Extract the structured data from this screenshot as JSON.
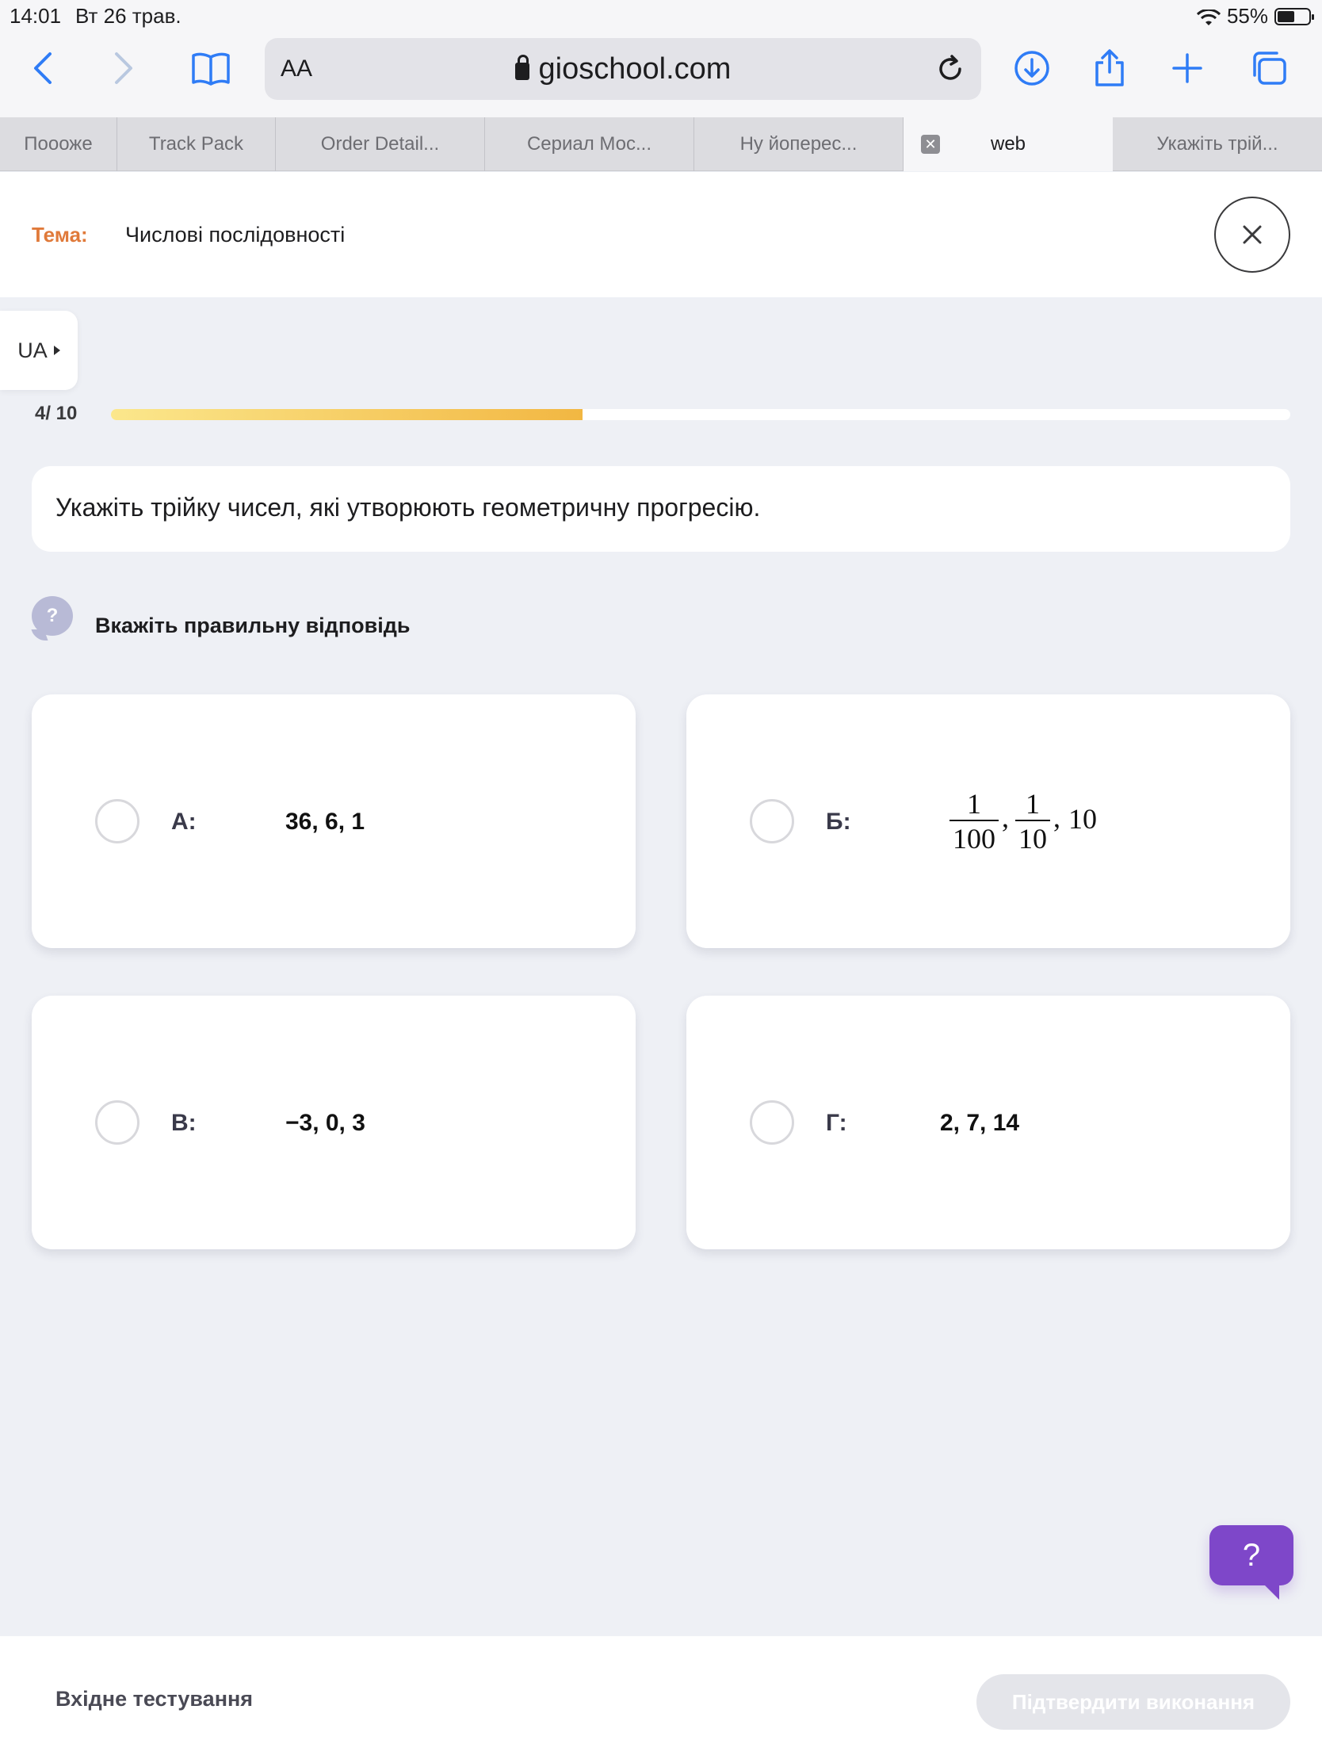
{
  "status_bar": {
    "time": "14:01",
    "date": "Вт 26 трав.",
    "battery": "55%",
    "battery_level": 0.55
  },
  "browser": {
    "reader_label": "AA",
    "url": "gioschool.com",
    "tabs": [
      {
        "label": "Поооже"
      },
      {
        "label": "Track Pack"
      },
      {
        "label": "Order Detail..."
      },
      {
        "label": "Сериал Мос..."
      },
      {
        "label": "Ну йоперес..."
      },
      {
        "label": "web"
      },
      {
        "label": "Укажіть трій..."
      }
    ],
    "active_tab_index": 5
  },
  "header": {
    "topic_label": "Тема:",
    "topic_value": "Числові послідовності"
  },
  "language": {
    "selected": "UA"
  },
  "progress": {
    "text": "4/ 10",
    "current": 4,
    "total": 10,
    "fraction": 0.4
  },
  "question": {
    "text": "Укажіть трійку чисел, які утворюють геометричну прогресію.",
    "hint": "Вкажіть правильну відповідь",
    "hint_icon": "?"
  },
  "options": [
    {
      "letter": "А:",
      "value": "36, 6, 1"
    },
    {
      "letter": "Б:",
      "fraction1": {
        "num": "1",
        "den": "100"
      },
      "fraction2": {
        "num": "1",
        "den": "10"
      },
      "comma": ",",
      "tail": "10"
    },
    {
      "letter": "В:",
      "value": "−3, 0, 3"
    },
    {
      "letter": "Г:",
      "value": "2, 7, 14"
    }
  ],
  "help_button": "?",
  "footer": {
    "left_text": "Вхідне тестування",
    "submit_label": "Підтвердити виконання"
  },
  "colors": {
    "accent_orange": "#e07a3a",
    "progress_start": "#fbe78c",
    "progress_end": "#f2b742",
    "help_purple": "#7e47c9",
    "safari_blue": "#2f7cf6"
  }
}
